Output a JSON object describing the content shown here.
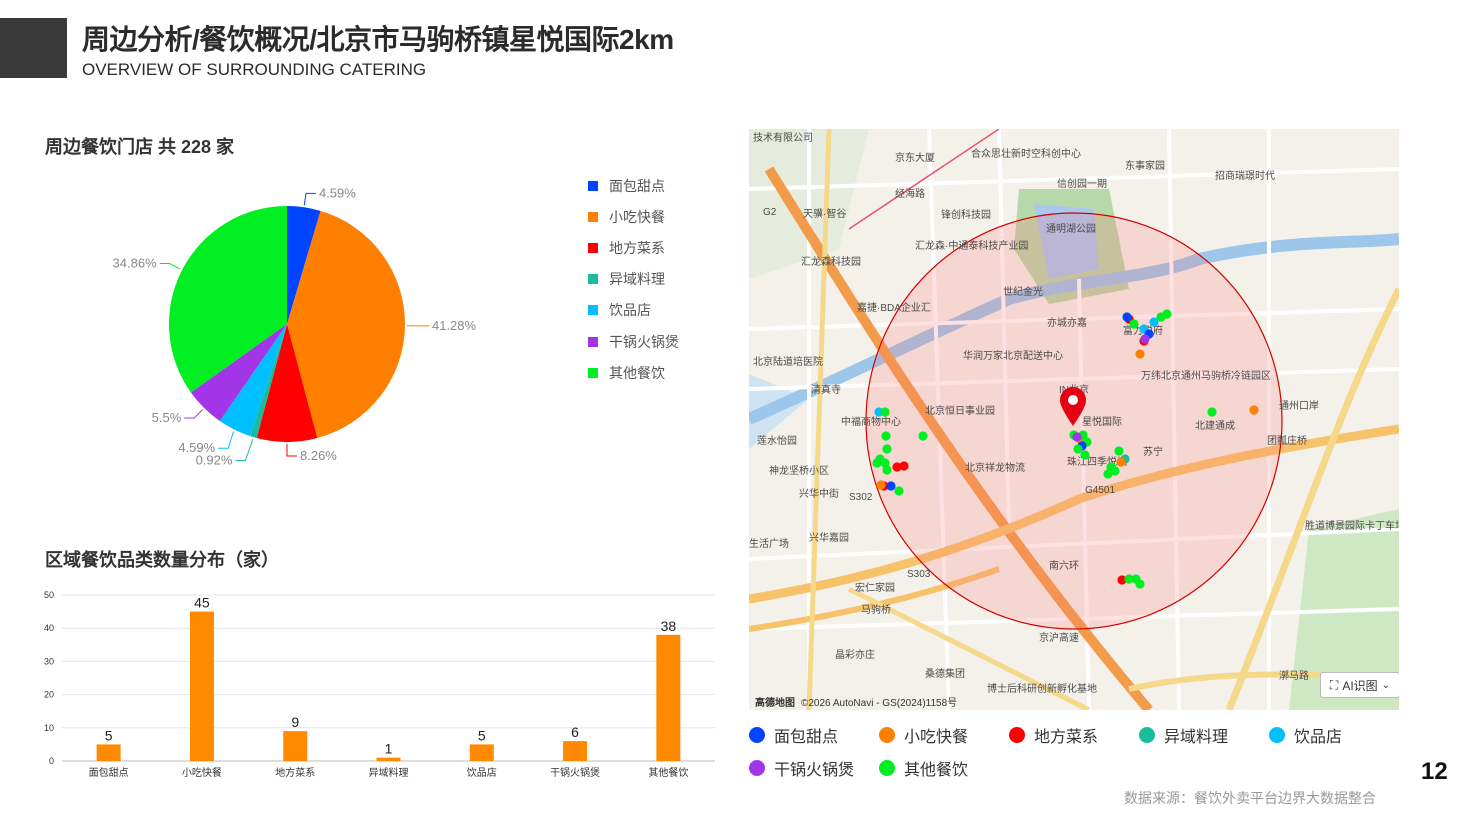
{
  "header": {
    "title": "周边分析/餐饮概况/北京市马驹桥镇星悦国际2km",
    "subtitle": "OVERVIEW OF SURROUNDING CATERING"
  },
  "pie_section": {
    "title": "周边餐饮门店 共 228 家"
  },
  "bar_section": {
    "title": "区域餐饮品类数量分布（家）"
  },
  "chart_data": [
    {
      "type": "pie",
      "title": "周边餐饮门店 共 228 家",
      "slices": [
        {
          "name": "面包甜点",
          "percent": 4.59,
          "label": "4.59%",
          "color": "#0044ff"
        },
        {
          "name": "小吃快餐",
          "percent": 41.28,
          "label": "41.28%",
          "color": "#ff7f00"
        },
        {
          "name": "地方菜系",
          "percent": 8.26,
          "label": "8.26%",
          "color": "#ff0000"
        },
        {
          "name": "异域料理",
          "percent": 0.92,
          "label": "0.92%",
          "color": "#1abc9c"
        },
        {
          "name": "饮品店",
          "percent": 4.59,
          "label": "4.59%",
          "color": "#00bfff"
        },
        {
          "name": "干锅火锅煲",
          "percent": 5.5,
          "label": "5.5%",
          "color": "#a335e8"
        },
        {
          "name": "其他餐饮",
          "percent": 34.86,
          "label": "34.86%",
          "color": "#00ee22"
        }
      ]
    },
    {
      "type": "bar",
      "title": "区域餐饮品类数量分布（家）",
      "categories": [
        "面包甜点",
        "小吃快餐",
        "地方菜系",
        "异域料理",
        "饮品店",
        "干锅火锅煲",
        "其他餐饮"
      ],
      "values": [
        5,
        45,
        9,
        1,
        5,
        6,
        38
      ],
      "ylim": [
        0,
        50
      ],
      "yticks": [
        0,
        10,
        20,
        30,
        40,
        50
      ],
      "grid": true,
      "color": "#ff8a00"
    }
  ],
  "map": {
    "labels": [
      "技术有限公司",
      "京东大厦",
      "合众思壮新时空科创中心",
      "信创园一期",
      "东事家园",
      "招商瑞璟时代",
      "经海路",
      "天骥·智谷",
      "锋创科技园",
      "通明湖公园",
      "汇龙森·中通泰科技产业园",
      "汇龙森科技园",
      "世纪金光",
      "嘉捷·BDA企业汇",
      "亦城亦嘉",
      "富力悦府",
      "北京陆道培医院",
      "华润万家北京配送中心",
      "万纬北京通州马驹桥冷链园区",
      "清真寺",
      "IN北京",
      "通州口岸",
      "北京恒日事业园",
      "星悦国际",
      "中福商物中心",
      "北建通成",
      "团瓢庄桥",
      "莲水怡园",
      "苏宁",
      "神龙坚桥小区",
      "北京祥龙物流",
      "珠江四季悦城",
      "兴华中街",
      "兴华嘉园",
      "生活广场",
      "胜道博景园际卡丁车场",
      "宏仁家园",
      "马驹桥",
      "晶彩亦庄",
      "桑德集团",
      "博士后科研创新孵化基地",
      "高德地图",
      "©2026 AutoNavi - GS(2024)1158号",
      "AI识图",
      "京沪高速",
      "南六环",
      "G4501",
      "S302",
      "S303",
      "G2",
      "漷马路"
    ],
    "categories": [
      {
        "name": "面包甜点",
        "color": "#0044ff"
      },
      {
        "name": "小吃快餐",
        "color": "#ff7f00"
      },
      {
        "name": "地方菜系",
        "color": "#ff0000"
      },
      {
        "name": "异域料理",
        "color": "#1abc9c"
      },
      {
        "name": "饮品店",
        "color": "#00bfff"
      },
      {
        "name": "干锅火锅煲",
        "color": "#a335e8"
      },
      {
        "name": "其他餐饮",
        "color": "#00ee22"
      }
    ]
  },
  "legend": [
    {
      "name": "面包甜点",
      "color": "#0044ff"
    },
    {
      "name": "小吃快餐",
      "color": "#ff7f00"
    },
    {
      "name": "地方菜系",
      "color": "#ff0000"
    },
    {
      "name": "异域料理",
      "color": "#1abc9c"
    },
    {
      "name": "饮品店",
      "color": "#00bfff"
    },
    {
      "name": "干锅火锅煲",
      "color": "#a335e8"
    },
    {
      "name": "其他餐饮",
      "color": "#00ee22"
    }
  ],
  "footer": {
    "page_number": "12",
    "source": "数据来源：餐饮外卖平台边界大数据整合"
  }
}
